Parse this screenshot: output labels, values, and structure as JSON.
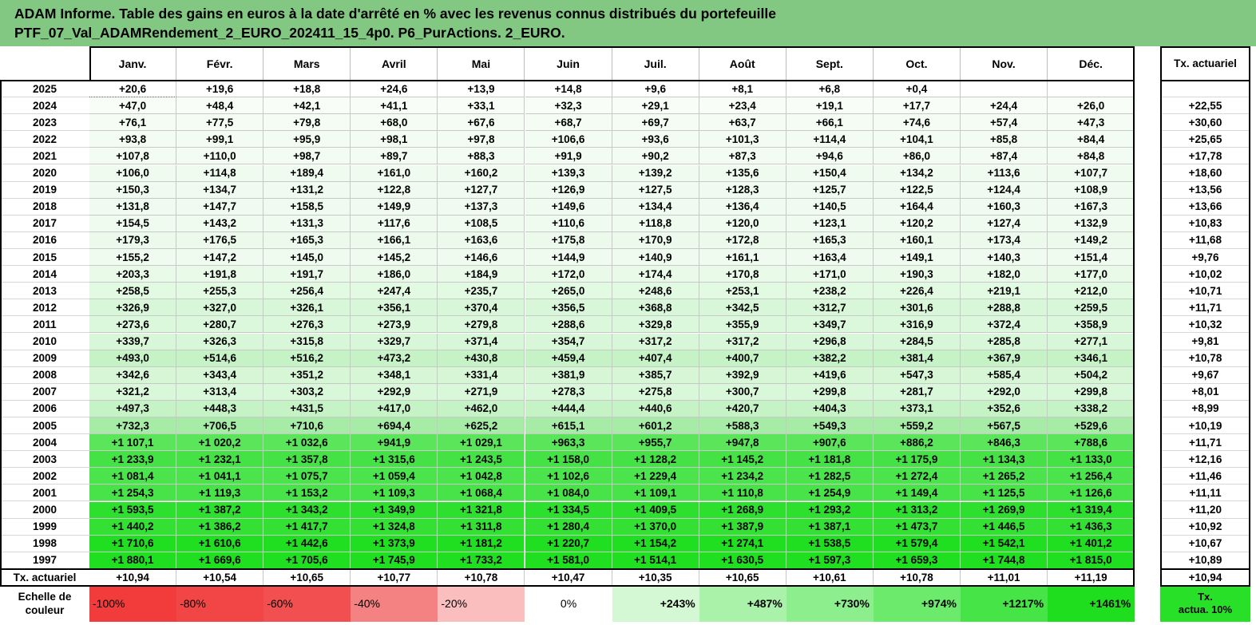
{
  "title": {
    "line1": "ADAM Informe. Table des gains en euros à la date d'arrêté en % avec les revenus connus distribués du portefeuille",
    "line2": "PTF_07_Val_ADAMRendement_2_EURO_202411_15_4p0. P6_PurActions. 2_EURO."
  },
  "header": {
    "months": [
      "Janv.",
      "Févr.",
      "Mars",
      "Avril",
      "Mai",
      "Juin",
      "Juil.",
      "Août",
      "Sept.",
      "Oct.",
      "Nov.",
      "Déc."
    ],
    "rate_label": "Tx. actuariel"
  },
  "rows": [
    {
      "year": "2025",
      "values": [
        "+20,6",
        "+19,6",
        "+18,8",
        "+24,6",
        "+13,9",
        "+14,8",
        "+9,6",
        "+8,1",
        "+6,8",
        "+0,4",
        "",
        ""
      ],
      "rate": ""
    },
    {
      "year": "2024",
      "values": [
        "+47,0",
        "+48,4",
        "+42,1",
        "+41,1",
        "+33,1",
        "+32,3",
        "+29,1",
        "+23,4",
        "+19,1",
        "+17,7",
        "+24,4",
        "+26,0"
      ],
      "rate": "+22,55"
    },
    {
      "year": "2023",
      "values": [
        "+76,1",
        "+77,5",
        "+79,8",
        "+68,0",
        "+67,6",
        "+68,7",
        "+69,7",
        "+63,7",
        "+66,1",
        "+74,6",
        "+57,4",
        "+47,3"
      ],
      "rate": "+30,60"
    },
    {
      "year": "2022",
      "values": [
        "+93,8",
        "+99,1",
        "+95,9",
        "+98,1",
        "+97,8",
        "+106,6",
        "+93,6",
        "+101,3",
        "+114,4",
        "+104,1",
        "+85,8",
        "+84,4"
      ],
      "rate": "+25,65"
    },
    {
      "year": "2021",
      "values": [
        "+107,8",
        "+110,0",
        "+98,7",
        "+89,7",
        "+88,3",
        "+91,9",
        "+90,2",
        "+87,3",
        "+94,6",
        "+86,0",
        "+87,4",
        "+84,8"
      ],
      "rate": "+17,78"
    },
    {
      "year": "2020",
      "values": [
        "+106,0",
        "+114,8",
        "+189,4",
        "+161,0",
        "+160,2",
        "+139,3",
        "+139,2",
        "+135,6",
        "+150,4",
        "+134,2",
        "+113,6",
        "+107,7"
      ],
      "rate": "+18,60"
    },
    {
      "year": "2019",
      "values": [
        "+150,3",
        "+134,7",
        "+131,2",
        "+122,8",
        "+127,7",
        "+126,9",
        "+127,5",
        "+128,3",
        "+125,7",
        "+122,5",
        "+124,4",
        "+108,9"
      ],
      "rate": "+13,56"
    },
    {
      "year": "2018",
      "values": [
        "+131,8",
        "+147,7",
        "+158,5",
        "+149,9",
        "+137,3",
        "+149,6",
        "+134,4",
        "+136,4",
        "+140,5",
        "+164,4",
        "+160,3",
        "+167,3"
      ],
      "rate": "+13,66"
    },
    {
      "year": "2017",
      "values": [
        "+154,5",
        "+143,2",
        "+131,3",
        "+117,6",
        "+108,5",
        "+110,6",
        "+118,8",
        "+120,0",
        "+123,1",
        "+120,2",
        "+127,4",
        "+132,9"
      ],
      "rate": "+10,83"
    },
    {
      "year": "2016",
      "values": [
        "+179,3",
        "+176,5",
        "+165,3",
        "+166,1",
        "+163,6",
        "+175,8",
        "+170,9",
        "+172,8",
        "+165,3",
        "+160,1",
        "+173,4",
        "+149,2"
      ],
      "rate": "+11,68"
    },
    {
      "year": "2015",
      "values": [
        "+155,2",
        "+147,2",
        "+145,0",
        "+145,2",
        "+146,6",
        "+144,9",
        "+140,9",
        "+161,1",
        "+163,4",
        "+149,1",
        "+140,3",
        "+151,4"
      ],
      "rate": "+9,76"
    },
    {
      "year": "2014",
      "values": [
        "+203,3",
        "+191,8",
        "+191,7",
        "+186,0",
        "+184,9",
        "+172,0",
        "+174,4",
        "+170,8",
        "+171,0",
        "+190,3",
        "+182,0",
        "+177,0"
      ],
      "rate": "+10,02"
    },
    {
      "year": "2013",
      "values": [
        "+258,5",
        "+255,3",
        "+256,4",
        "+247,4",
        "+235,7",
        "+265,0",
        "+248,6",
        "+253,1",
        "+238,2",
        "+226,4",
        "+219,1",
        "+212,0"
      ],
      "rate": "+10,71"
    },
    {
      "year": "2012",
      "values": [
        "+326,9",
        "+327,0",
        "+326,1",
        "+356,1",
        "+370,4",
        "+356,5",
        "+368,8",
        "+342,5",
        "+312,7",
        "+301,6",
        "+288,8",
        "+259,5"
      ],
      "rate": "+11,71"
    },
    {
      "year": "2011",
      "values": [
        "+273,6",
        "+280,7",
        "+276,3",
        "+273,9",
        "+279,8",
        "+288,6",
        "+329,8",
        "+355,9",
        "+349,7",
        "+316,9",
        "+372,4",
        "+358,9"
      ],
      "rate": "+10,32"
    },
    {
      "year": "2010",
      "values": [
        "+339,7",
        "+326,3",
        "+315,8",
        "+329,7",
        "+371,4",
        "+354,7",
        "+317,2",
        "+317,2",
        "+296,8",
        "+284,5",
        "+285,8",
        "+277,1"
      ],
      "rate": "+9,81"
    },
    {
      "year": "2009",
      "values": [
        "+493,0",
        "+514,6",
        "+516,2",
        "+473,2",
        "+430,8",
        "+459,4",
        "+407,4",
        "+400,7",
        "+382,2",
        "+381,4",
        "+367,9",
        "+346,1"
      ],
      "rate": "+10,78"
    },
    {
      "year": "2008",
      "values": [
        "+342,6",
        "+343,4",
        "+351,2",
        "+348,1",
        "+331,4",
        "+381,9",
        "+385,7",
        "+392,9",
        "+419,6",
        "+547,3",
        "+585,4",
        "+504,2"
      ],
      "rate": "+9,67"
    },
    {
      "year": "2007",
      "values": [
        "+321,2",
        "+313,4",
        "+303,2",
        "+292,9",
        "+271,9",
        "+278,3",
        "+275,8",
        "+300,7",
        "+299,8",
        "+281,7",
        "+292,0",
        "+299,8"
      ],
      "rate": "+8,01"
    },
    {
      "year": "2006",
      "values": [
        "+497,3",
        "+448,3",
        "+431,5",
        "+417,0",
        "+462,0",
        "+444,4",
        "+440,6",
        "+420,7",
        "+404,3",
        "+373,1",
        "+352,6",
        "+338,2"
      ],
      "rate": "+8,99"
    },
    {
      "year": "2005",
      "values": [
        "+732,3",
        "+706,5",
        "+710,6",
        "+694,4",
        "+625,2",
        "+615,1",
        "+601,2",
        "+588,3",
        "+549,3",
        "+559,2",
        "+567,5",
        "+529,6"
      ],
      "rate": "+10,19"
    },
    {
      "year": "2004",
      "values": [
        "+1 107,1",
        "+1 020,2",
        "+1 032,6",
        "+941,9",
        "+1 029,1",
        "+963,3",
        "+955,7",
        "+947,8",
        "+907,6",
        "+886,2",
        "+846,3",
        "+788,6"
      ],
      "rate": "+11,71"
    },
    {
      "year": "2003",
      "values": [
        "+1 233,9",
        "+1 232,1",
        "+1 357,8",
        "+1 315,6",
        "+1 243,5",
        "+1 158,0",
        "+1 128,2",
        "+1 145,2",
        "+1 181,8",
        "+1 175,9",
        "+1 134,3",
        "+1 133,0"
      ],
      "rate": "+12,16"
    },
    {
      "year": "2002",
      "values": [
        "+1 081,4",
        "+1 041,1",
        "+1 075,7",
        "+1 059,4",
        "+1 042,8",
        "+1 102,6",
        "+1 229,4",
        "+1 234,2",
        "+1 282,5",
        "+1 272,4",
        "+1 265,2",
        "+1 256,4"
      ],
      "rate": "+11,46"
    },
    {
      "year": "2001",
      "values": [
        "+1 254,3",
        "+1 119,3",
        "+1 153,2",
        "+1 109,3",
        "+1 068,4",
        "+1 084,0",
        "+1 109,1",
        "+1 110,8",
        "+1 254,9",
        "+1 149,4",
        "+1 125,5",
        "+1 126,6"
      ],
      "rate": "+11,11"
    },
    {
      "year": "2000",
      "values": [
        "+1 593,5",
        "+1 387,2",
        "+1 343,2",
        "+1 349,9",
        "+1 321,8",
        "+1 334,5",
        "+1 409,5",
        "+1 268,9",
        "+1 293,2",
        "+1 313,2",
        "+1 269,9",
        "+1 319,4"
      ],
      "rate": "+11,20"
    },
    {
      "year": "1999",
      "values": [
        "+1 440,2",
        "+1 386,2",
        "+1 417,7",
        "+1 324,8",
        "+1 311,8",
        "+1 280,4",
        "+1 370,0",
        "+1 387,9",
        "+1 387,1",
        "+1 473,7",
        "+1 446,5",
        "+1 436,3"
      ],
      "rate": "+10,92"
    },
    {
      "year": "1998",
      "values": [
        "+1 710,6",
        "+1 610,6",
        "+1 442,6",
        "+1 373,9",
        "+1 181,2",
        "+1 220,7",
        "+1 154,2",
        "+1 274,1",
        "+1 538,5",
        "+1 579,4",
        "+1 542,1",
        "+1 401,2"
      ],
      "rate": "+10,67"
    },
    {
      "year": "1997",
      "values": [
        "+1 880,1",
        "+1 669,6",
        "+1 705,6",
        "+1 745,9",
        "+1 733,2",
        "+1 581,0",
        "+1 514,1",
        "+1 630,5",
        "+1 597,3",
        "+1 659,3",
        "+1 744,8",
        "+1 815,0"
      ],
      "rate": "+10,89"
    }
  ],
  "row_colors": [
    "#ffffff",
    "#f8fdf8",
    "#f4fcf4",
    "#f2fcf2",
    "#f2fcf2",
    "#effbef",
    "#eefbee",
    "#eefbee",
    "#eefbee",
    "#ebfaeb",
    "#eefbee",
    "#e9fae9",
    "#e2f9e2",
    "#d8f7d8",
    "#dcf8dc",
    "#d8f7d8",
    "#c6f3c6",
    "#d6f6d6",
    "#d9f7d9",
    "#c6f3c6",
    "#a6eca6",
    "#5ae55a",
    "#44e244",
    "#4ce44c",
    "#48e348",
    "#2ee02e",
    "#33e033",
    "#20de20",
    "#20de20"
  ],
  "footer": {
    "label": "Tx. actuariel",
    "values": [
      "+10,94",
      "+10,54",
      "+10,65",
      "+10,77",
      "+10,78",
      "+10,47",
      "+10,35",
      "+10,65",
      "+10,61",
      "+10,78",
      "+11,01",
      "+11,19"
    ],
    "rate": "+10,94"
  },
  "legend": {
    "label_line1": "Echelle de",
    "label_line2": "couleur",
    "steps": [
      {
        "text": "-100%",
        "color": "#f23c3c"
      },
      {
        "text": "-80%",
        "color": "#f24646"
      },
      {
        "text": "-60%",
        "color": "#f25050"
      },
      {
        "text": "-40%",
        "color": "#f58282"
      },
      {
        "text": "-20%",
        "color": "#fabebe"
      },
      {
        "text": "0%",
        "color": "#ffffff"
      },
      {
        "text": "+243%",
        "color": "#d4f8d4"
      },
      {
        "text": "+487%",
        "color": "#aaf2aa"
      },
      {
        "text": "+730%",
        "color": "#8cee8c"
      },
      {
        "text": "+974%",
        "color": "#6cea6c"
      },
      {
        "text": "+1217%",
        "color": "#46e446"
      },
      {
        "text": "+1461%",
        "color": "#1ede1e"
      }
    ],
    "last_line1": "Tx.",
    "last_line2": "actua. 10%",
    "last_color": "#28e028"
  }
}
